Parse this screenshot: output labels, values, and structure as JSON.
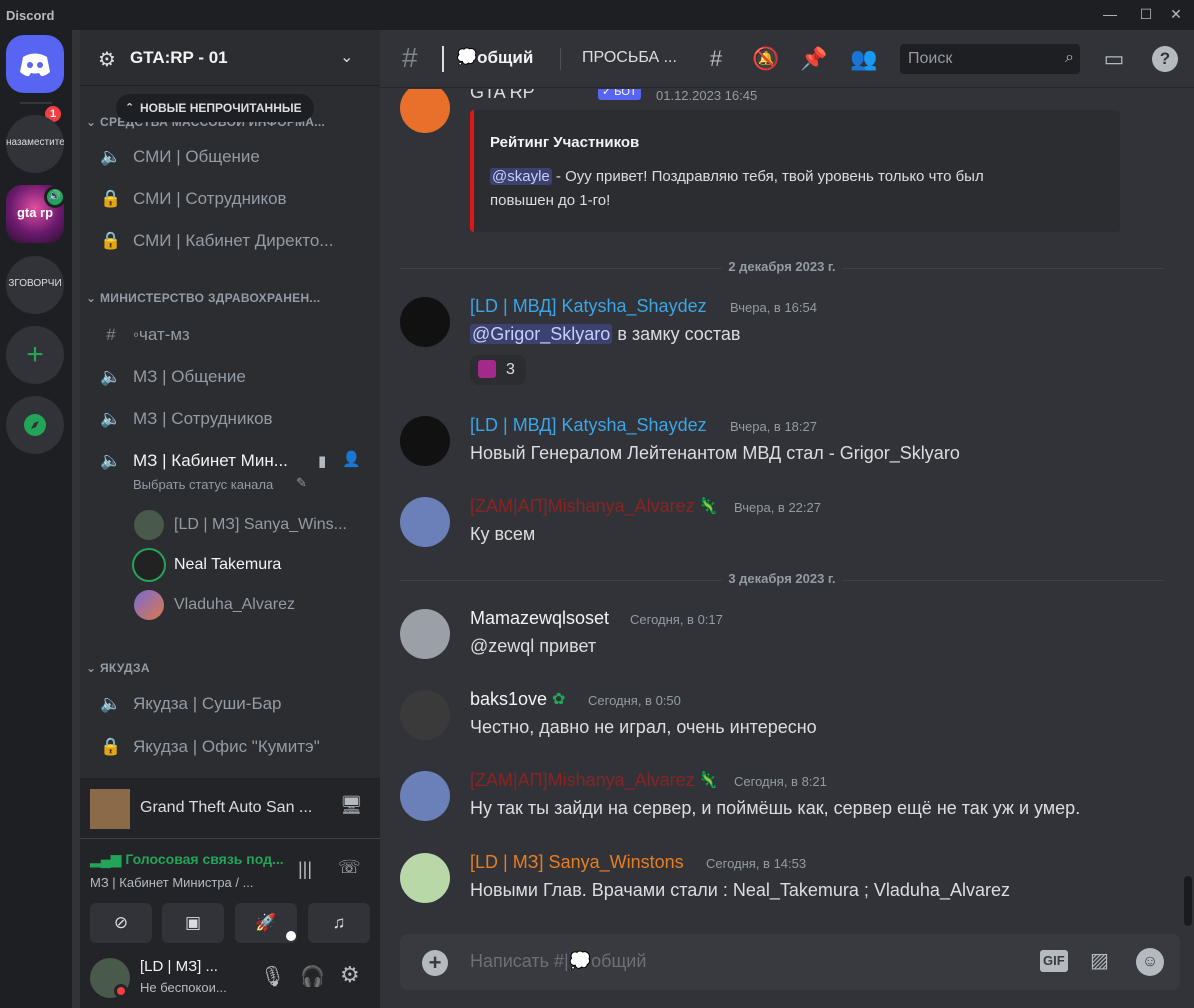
{
  "titlebar": {
    "app_name": "Discord",
    "minimize": "—",
    "maximize": "☐",
    "close": "✕"
  },
  "guilds": {
    "home_badge": "1",
    "items": [
      {
        "label": "назаместите"
      },
      {
        "label": "gta rp"
      },
      {
        "label": "ЗГОВОРЧИ"
      }
    ]
  },
  "server": {
    "name": "GTA:RP - 01",
    "unread_pill": "НОВЫЕ НЕПРОЧИТАННЫЕ",
    "categories": [
      {
        "name": "СРЕДСТВА МАССОВОЙ ИНФОРМА..."
      },
      {
        "name": "МИНИСТЕРСТВО ЗДРАВОХРАНЕН..."
      },
      {
        "name": "ЯКУДЗА"
      }
    ],
    "channels": [
      {
        "label": "СМИ | Общение"
      },
      {
        "label": "СМИ | Сотрудников"
      },
      {
        "label": "СМИ | Кабинет Директо..."
      },
      {
        "label": "◦чат-мз"
      },
      {
        "label": "МЗ | Общение"
      },
      {
        "label": "МЗ | Сотрудников"
      },
      {
        "label": "МЗ | Кабинет Мин...",
        "status": "Выбрать статус канала"
      },
      {
        "label": "Якудза | Суши-Бар"
      },
      {
        "label": "Якудза | Офис \"Кумитэ\""
      }
    ],
    "voice_users": [
      {
        "name": "[LD | МЗ] Sanya_Wins..."
      },
      {
        "name": "Neal Takemura"
      },
      {
        "name": "Vladuha_Alvarez"
      }
    ]
  },
  "activity": {
    "game": "Grand Theft Auto San ..."
  },
  "voice_panel": {
    "status": "Голосовая связь под...",
    "channel": "МЗ | Кабинет Министра / ..."
  },
  "user": {
    "name": "[LD | МЗ] ...",
    "status": "Не беспокои..."
  },
  "header": {
    "channel": "общий",
    "thread": "ПРОСЬБА ...",
    "search_placeholder": "Поиск"
  },
  "messages": [
    {
      "author": "GTA RP",
      "bot_tag": "✓ БОТ",
      "time": "01.12.2023 16:45",
      "embed_title": "Рейтинг Участников",
      "embed_mention": "@skayle",
      "embed_text": " - Оуу привет! Поздравляю тебя, твой уровень только что был",
      "embed_text2": "повышен до 1-го!"
    },
    {
      "divider": "2 декабря 2023 г."
    },
    {
      "author": "[LD | МВД] Katysha_Shaydez",
      "time": "Вчера, в 16:54",
      "mention": "@Grigor_Sklyaro",
      "text": " в замку состав",
      "reaction_count": "3"
    },
    {
      "author": "[LD | МВД] Katysha_Shaydez",
      "time": "Вчера, в 18:27",
      "text": "Новый Генералом Лейтенантом МВД стал - Grigor_Sklyaro"
    },
    {
      "author": "[ZAM|AП]Mishanya_Alvarez",
      "time": "Вчера, в 22:27",
      "text": "Ку всем"
    },
    {
      "divider": "3 декабря 2023 г."
    },
    {
      "author": "Mamazewqlsoset",
      "time": "Сегодня, в 0:17",
      "text": "@zewql привет"
    },
    {
      "author": "baks1ove",
      "time": "Сегодня, в 0:50",
      "text": "Честно, давно не играл, очень интересно"
    },
    {
      "author": "[ZAM|AП]Mishanya_Alvarez",
      "time": "Сегодня, в 8:21",
      "text": "Ну так ты зайди на сервер, и поймёшь как, сервер ещё не так уж и умер."
    },
    {
      "author": "[LD | МЗ] Sanya_Winstons",
      "time": "Сегодня, в 14:53",
      "text": "Новыми Глав. Врачами стали : Neal_Takemura ; Vladuha_Alvarez"
    }
  ],
  "composer": {
    "prefix": "Написать #|",
    "channel": "общий",
    "gif": "GIF"
  },
  "colors": {
    "bg": "#313338",
    "sidebar": "#2b2d31",
    "rail": "#1e1f22",
    "mvd_blue": "#3ba5e6",
    "zam_red": "#8b2323",
    "mz_orange": "#e67e22",
    "green": "#23a559",
    "embed_red": "#e01515",
    "bot": "#5865f2"
  }
}
